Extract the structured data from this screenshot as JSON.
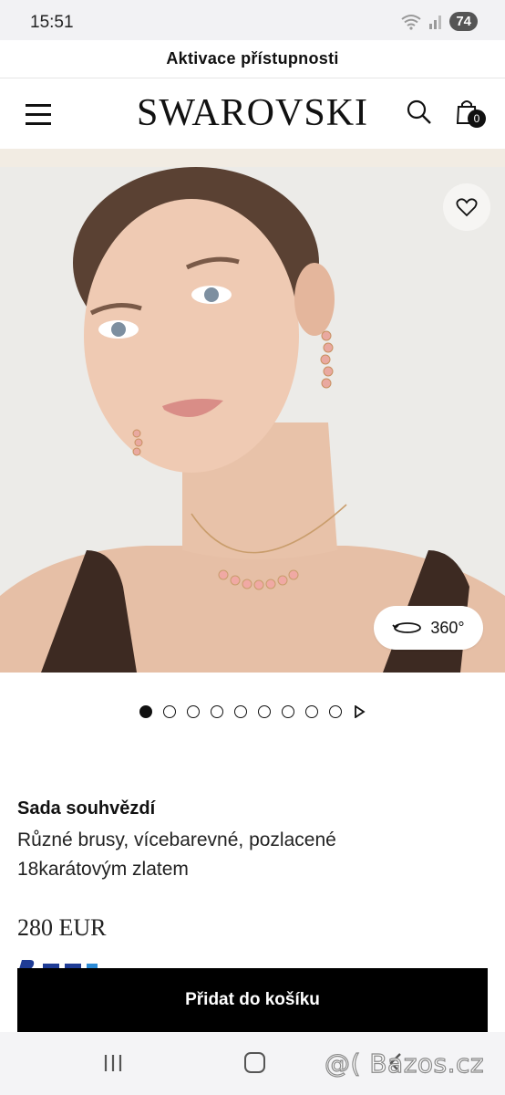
{
  "status_bar": {
    "time": "15:51",
    "battery": "74"
  },
  "accessibility_bar": {
    "label": "Aktivace přístupnosti"
  },
  "header": {
    "logo": "SWAROVSKI",
    "bag_count": "0"
  },
  "gallery": {
    "view_360_label": "360°",
    "slide_count": 9,
    "active_slide": 1
  },
  "product": {
    "name": "Sada souhvězdí",
    "description": "Různé brusy, vícebarevné, pozlacené 18karátovým zlatem",
    "price": "280 EUR"
  },
  "cta": {
    "add_to_cart": "Přidat do košíku"
  },
  "watermark": {
    "text": "@( Bazos.cz"
  },
  "colors": {
    "primary": "#000000",
    "background": "#ffffff",
    "accent_beige": "#f2ece3"
  },
  "icons": [
    "menu-icon",
    "search-icon",
    "bag-icon",
    "heart-icon",
    "rotate-360-icon",
    "chevron-right-icon",
    "recents-icon",
    "home-icon",
    "back-icon"
  ]
}
